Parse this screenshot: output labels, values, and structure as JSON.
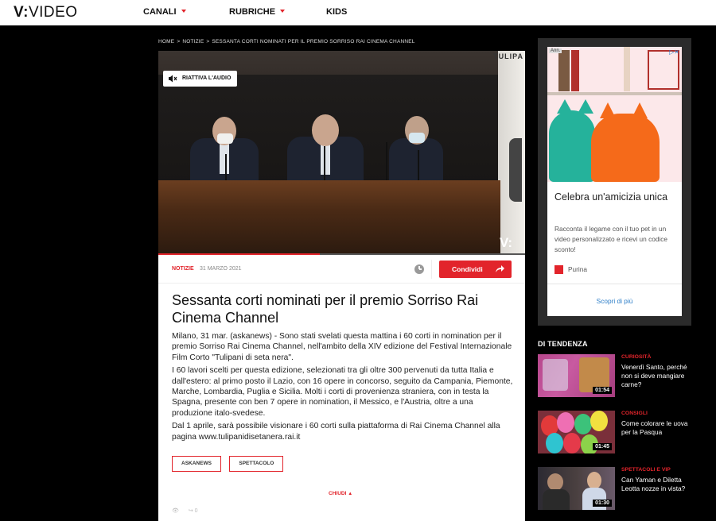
{
  "header": {
    "logo_mark": "V:",
    "logo_text": "VIDEO",
    "nav": [
      {
        "label": "CANALI",
        "has_dropdown": true
      },
      {
        "label": "RUBRICHE",
        "has_dropdown": true
      },
      {
        "label": "KIDS",
        "has_dropdown": false
      }
    ],
    "accent_color": "#e2242b"
  },
  "breadcrumb": [
    "HOME",
    "NOTIZIE",
    "SESSANTA CORTI NOMINATI PER IL PREMIO SORRISO RAI CINEMA CHANNEL"
  ],
  "video": {
    "unmute_label": "RIATTIVA L'AUDIO",
    "watermark": "V:",
    "banner_text": "TULIPA",
    "progress": 0.44
  },
  "article": {
    "category": "NOTIZIE",
    "date": "31 MARZO 2021",
    "share_label": "Condividi",
    "title": "Sessanta corti nominati per il premio Sorriso Rai Cinema Channel",
    "paragraphs": [
      "Milano, 31 mar. (askanews) - Sono stati svelati questa mattina i 60 corti in nomination per il premio Sorriso Rai Cinema Channel, nell'ambito della XIV edizione del Festival Internazionale Film Corto \"Tulipani di seta nera\".",
      "I 60 lavori scelti per questa edizione, selezionati tra gli oltre 300 pervenuti da tutta Italia e dall'estero: al primo posto il Lazio, con 16 opere in concorso, seguito da Campania, Piemonte, Marche, Lombardia, Puglia e Sicilia. Molti i corti di provenienza straniera, con in testa la Spagna, presente con ben 7 opere in nomination, il Messico, e l'Austria, oltre a una produzione italo-svedese.",
      "Dal 1 aprile, sarà possibile visionare i 60 corti sulla piattaforma di Rai Cinema Channel alla pagina www.tulipanidisetanera.rai.it"
    ],
    "tags": [
      "ASKANEWS",
      "SPETTACOLO"
    ],
    "close_label": "CHIUDI",
    "share_count": "0"
  },
  "ad": {
    "label": "Ann.",
    "title": "Celebra un'amicizia unica",
    "description": "Racconta il legame con il tuo pet in un video personalizzato e ricevi un codice sconto!",
    "brand": "Purina",
    "cta": "Scopri di più"
  },
  "trending": {
    "heading": "DI TENDENZA",
    "items": [
      {
        "category": "CURIOSITÀ",
        "title": "Venerdì Santo, perché non si deve mangiare carne?",
        "duration": "01:54"
      },
      {
        "category": "CONSIGLI",
        "title": "Come colorare le uova per la Pasqua",
        "duration": "01:45"
      },
      {
        "category": "SPETTACOLI E VIP",
        "title": "Can Yaman e Diletta Leotta nozze in vista?",
        "duration": "01:30"
      }
    ]
  }
}
